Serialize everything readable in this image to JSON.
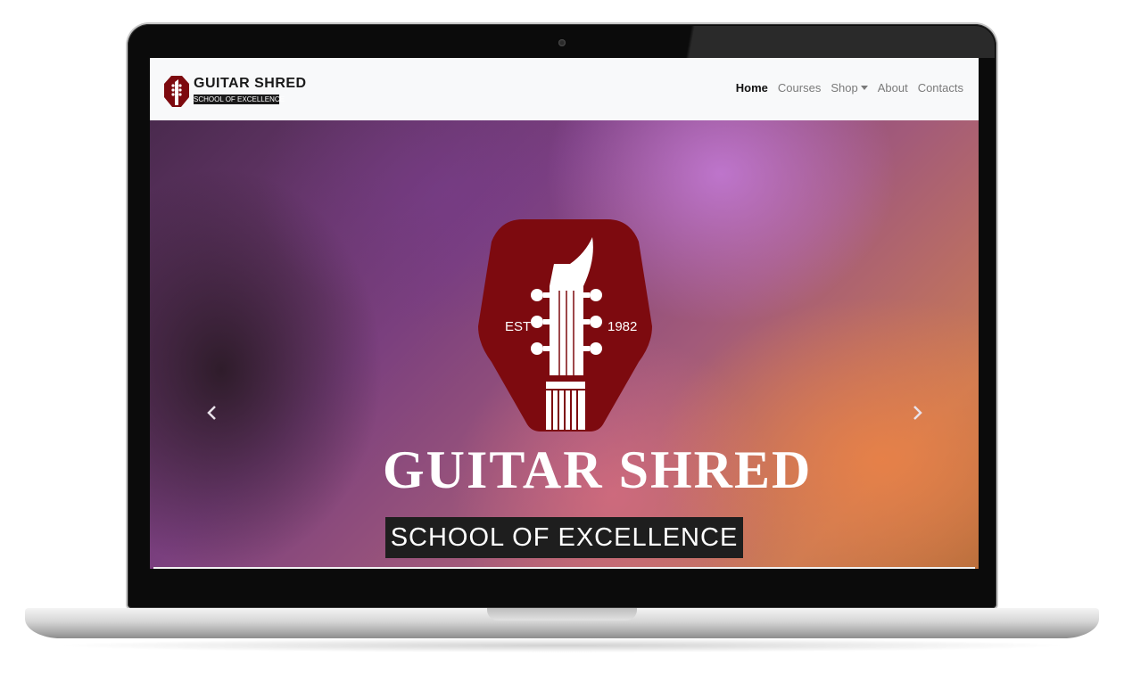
{
  "brand": {
    "name": "GUITAR SHRED",
    "tagline": "SCHOOL OF EXCELLENCE"
  },
  "nav": {
    "items": [
      {
        "label": "Home",
        "active": true
      },
      {
        "label": "Courses",
        "active": false
      },
      {
        "label": "Shop",
        "active": false,
        "dropdown": true
      },
      {
        "label": "About",
        "active": false
      },
      {
        "label": "Contacts",
        "active": false
      }
    ]
  },
  "hero": {
    "est": "EST",
    "year": "1982",
    "title": "GUITAR SHRED",
    "tagline": "SCHOOL OF EXCELLENCE",
    "prev_icon": "chevron-left-icon",
    "next_icon": "chevron-right-icon"
  },
  "colors": {
    "brand_red": "#7d0a0f",
    "navbar_bg": "#f8f9fa",
    "tag_bg": "#1e1e1e"
  }
}
